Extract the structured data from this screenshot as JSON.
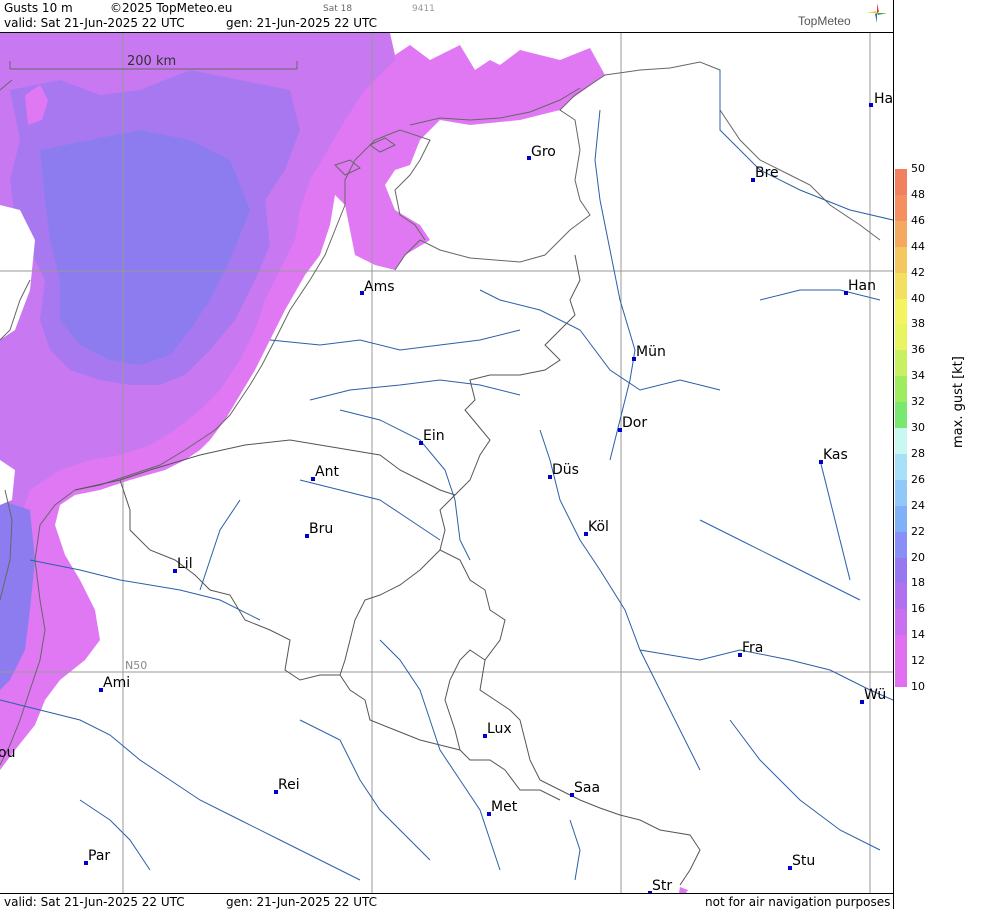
{
  "header": {
    "product": "Gusts 10 m",
    "copyright": "©2025 TopMeteo.eu",
    "run_label": "Sat 18",
    "code": "9411",
    "valid": "valid:  Sat  21-Jun-2025  22 UTC",
    "gen": "gen: 21-Jun-2025 22 UTC",
    "logo": "TopMeteo"
  },
  "map": {
    "scale_label": "200 km",
    "lat_label": "N50",
    "cities": [
      "Ha",
      "Gro",
      "Bre",
      "Ams",
      "Han",
      "Mün",
      "Dor",
      "Ein",
      "Ant",
      "Kas",
      "Düs",
      "Köl",
      "Bru",
      "Lil",
      "Fra",
      "Ami",
      "Wü",
      "Lux",
      "Rei",
      "Saa",
      "Met",
      "Par",
      "Stu",
      "Str",
      "ou"
    ]
  },
  "legend": {
    "title": "max. gust [kt]",
    "ticks": [
      "50",
      "48",
      "46",
      "44",
      "42",
      "40",
      "38",
      "36",
      "34",
      "32",
      "30",
      "28",
      "26",
      "24",
      "22",
      "20",
      "18",
      "16",
      "14",
      "12",
      "10"
    ],
    "colors": [
      "#f08060",
      "#f49060",
      "#f4a860",
      "#f4c860",
      "#f4e060",
      "#f4f460",
      "#e8f460",
      "#c8f060",
      "#a0ec60",
      "#78e870",
      "#c8f8f0",
      "#a8e0f8",
      "#90c8f8",
      "#80b0f8",
      "#8890f8",
      "#9878f0",
      "#b070f0",
      "#c870f0",
      "#e070f0",
      "#e070f0"
    ]
  },
  "footer": {
    "valid": "valid:  Sat  21-Jun-2025  22 UTC",
    "gen": "gen: 21-Jun-2025 22 UTC",
    "note": "not for air navigation purposes"
  }
}
